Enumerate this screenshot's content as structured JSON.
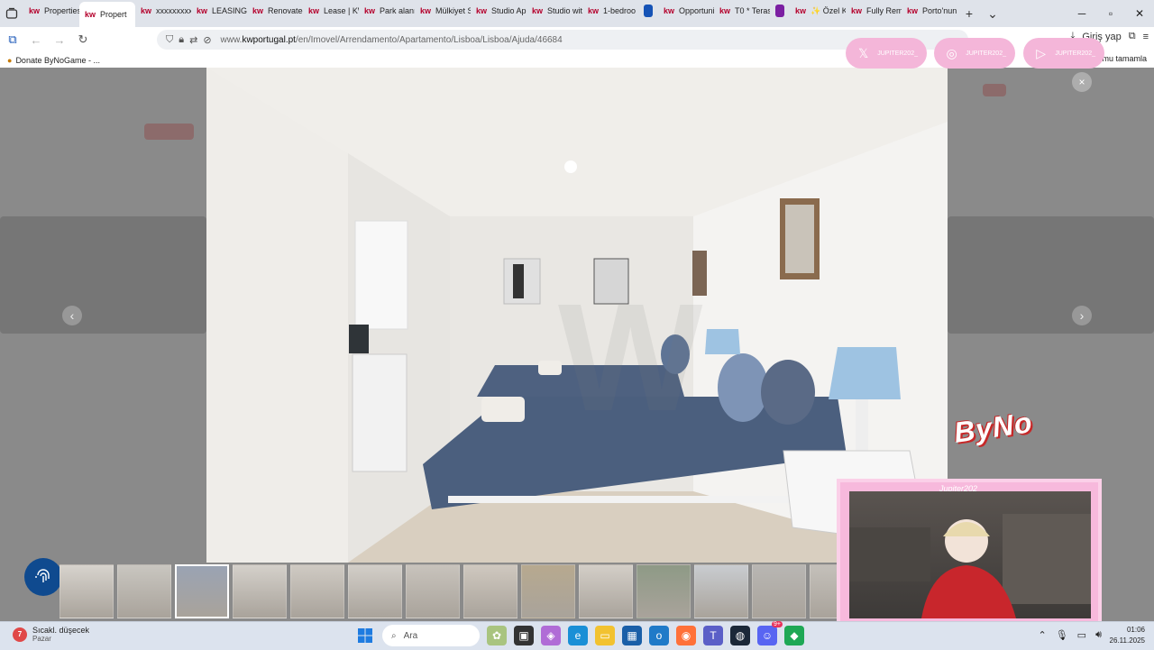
{
  "browser": {
    "tabs": [
      {
        "label": "Properties",
        "icon": "kw",
        "active": false
      },
      {
        "label": "Propert",
        "icon": "kw",
        "active": true
      },
      {
        "label": "xxxxxxxxx",
        "icon": "kw",
        "active": false
      },
      {
        "label": "LEASING |",
        "icon": "kw",
        "active": false
      },
      {
        "label": "Renovated",
        "icon": "kw",
        "active": false
      },
      {
        "label": "Lease | KW",
        "icon": "kw",
        "active": false
      },
      {
        "label": "Park alanı",
        "icon": "kw",
        "active": false
      },
      {
        "label": "Mülkiyet S",
        "icon": "kw",
        "active": false
      },
      {
        "label": "Studio Ap",
        "icon": "kw",
        "active": false
      },
      {
        "label": "Studio wit",
        "icon": "kw",
        "active": false
      },
      {
        "label": "1-bedroo",
        "icon": "kw",
        "active": false
      },
      {
        "label": "",
        "icon": "blue-square",
        "active": false
      },
      {
        "label": "Opportuni",
        "icon": "kw",
        "active": false
      },
      {
        "label": "T0 * Teras",
        "icon": "kw",
        "active": false
      },
      {
        "label": "",
        "icon": "purple-square",
        "active": false
      },
      {
        "label": "✨ Özel K",
        "icon": "kw",
        "active": false
      },
      {
        "label": "Fully Rem",
        "icon": "kw",
        "active": false
      },
      {
        "label": "Porto'nun",
        "icon": "kw",
        "active": false
      }
    ],
    "url_domain": "www.kwportugal.pt",
    "url_path": "/en/Imovel/Arrendamento/Apartamento/Lisboa/Lisboa/Ajuda/46684",
    "url_prefix": "www.",
    "url_host": "kwportugal.pt",
    "signin_label": "Giriş yap",
    "bookmark": "Donate ByNoGame - ...",
    "bookmark_right": "umu tamamla",
    "colors": {
      "kw_red": "#b4002b",
      "blue_tab": "#1553b6",
      "purple_tab": "#7b1fa2"
    }
  },
  "gallery": {
    "thumb_count": 14,
    "current_index": 2,
    "thumbs": [
      "Photo 1",
      "Photo 2",
      "Photo 3",
      "Photo 4",
      "Photo 5",
      "Photo 6",
      "Photo 7",
      "Photo 8",
      "Photo 9",
      "Photo 10",
      "Photo 11",
      "Photo 12",
      "Photo 13",
      "Photo 14"
    ],
    "prev_label": "‹",
    "next_label": "›",
    "close_label": "×",
    "accent": "#0f4a8f"
  },
  "overlay": {
    "socials": [
      {
        "icon": "x-icon",
        "handle": "JUPITER202_"
      },
      {
        "icon": "instagram-icon",
        "handle": "JUPITER202_"
      },
      {
        "icon": "youtube-icon",
        "handle": "JUPITER202_"
      }
    ],
    "brand": "ByNo",
    "cam_name": "Jupiter202_",
    "pink": "#f4b6d9"
  },
  "taskbar": {
    "weather_temp": "7",
    "weather_title": "Sıcakl. düşecek",
    "weather_sub": "Pazar",
    "search_placeholder": "Ara",
    "time": "01:06",
    "date": "26.11.2025",
    "badge_discord": "9+"
  }
}
